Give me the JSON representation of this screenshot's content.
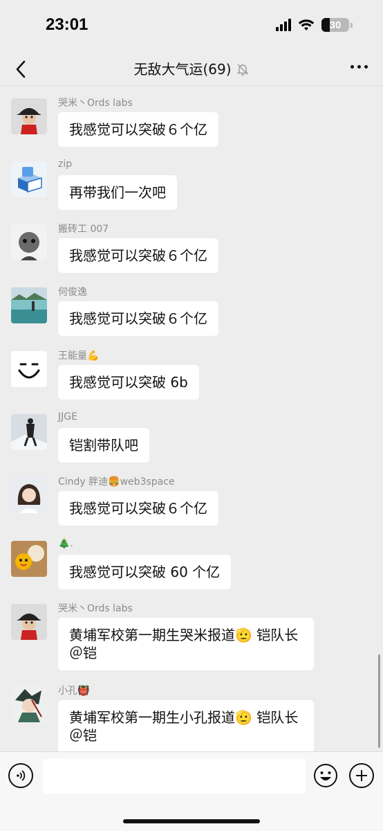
{
  "status_bar": {
    "time": "23:01",
    "battery": "30",
    "battery_level": 0.3
  },
  "header": {
    "title": "无敌大气运(69)",
    "back_icon": "chevron-left-icon",
    "mute_icon": "bell-off-icon",
    "more_icon": "more-horizontal-icon"
  },
  "messages": [
    {
      "sender": "哭米丶Ords labs",
      "text": "我感觉可以突破６个亿",
      "avatar": "avatar-hat-man"
    },
    {
      "sender": "zip",
      "text": "再带我们一次吧",
      "avatar": "avatar-box-logo"
    },
    {
      "sender": "搬砖工 007",
      "text": "我感觉可以突破６个亿",
      "avatar": "avatar-baby-bw"
    },
    {
      "sender": "何俊逸",
      "text": "我感觉可以突破６个亿",
      "avatar": "avatar-lake"
    },
    {
      "sender": "王能量💪",
      "text": "我感觉可以突破 6b",
      "avatar": "avatar-smile-face"
    },
    {
      "sender": "JJGE",
      "text": "铠割带队吧",
      "avatar": "avatar-climber"
    },
    {
      "sender": "Cindy 胖迪🍔web3space",
      "text": "我感觉可以突破６个亿",
      "avatar": "avatar-girl"
    },
    {
      "sender": "🎄.",
      "text": "我感觉可以突破 60 个亿",
      "avatar": "avatar-food"
    },
    {
      "sender": "哭米丶Ords labs",
      "text": "黄埔军校第一期生哭米报道🫡 铠队长＠铠",
      "avatar": "avatar-hat-man"
    },
    {
      "sender": "小孔👹",
      "text": "黄埔军校第一期生小孔报道🫡 铠队长＠铠",
      "avatar": "avatar-anime"
    }
  ],
  "input_bar": {
    "placeholder": "",
    "voice_icon": "voice-icon",
    "emoji_icon": "emoji-icon",
    "add_icon": "plus-icon"
  },
  "colors": {
    "background": "#ededed",
    "bubble": "#ffffff",
    "meta_text": "#8a8a8a"
  }
}
